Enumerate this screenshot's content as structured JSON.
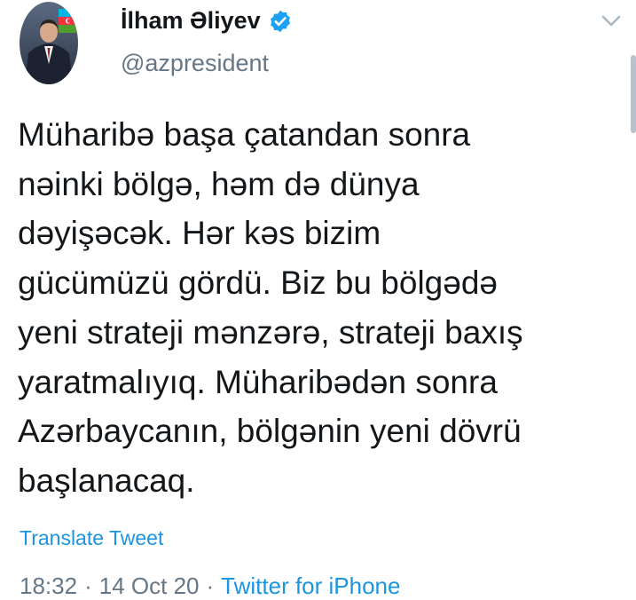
{
  "author": {
    "display_name": "İlham Əliyev",
    "handle": "@azpresident",
    "verified": true,
    "avatar_icon": "profile-photo-with-azerbaijan-flag"
  },
  "tweet": {
    "text": "Müharibə başa çatandan sonra\nnəinki bölgə, həm də dünya\ndəyişəcək. Hər kəs bizim\ngücümüzü gördü. Biz bu  bölgədə\nyeni strateji mənzərə, strateji baxış\nyaratmalıyıq. Müharibədən sonra\nAzərbaycanın, bölgənin yeni dövrü\nbaşlanacaq.",
    "translate_label": "Translate Tweet",
    "time": "18:32",
    "date": "14 Oct 20",
    "separator": "·",
    "source": "Twitter for iPhone"
  },
  "colors": {
    "link": "#1b95e0",
    "secondary_text": "#657786",
    "primary_text": "#14171a",
    "verified_badge": "#1da1f2"
  },
  "icons": {
    "verified": "verified-badge-icon",
    "menu": "chevron-down-icon"
  }
}
